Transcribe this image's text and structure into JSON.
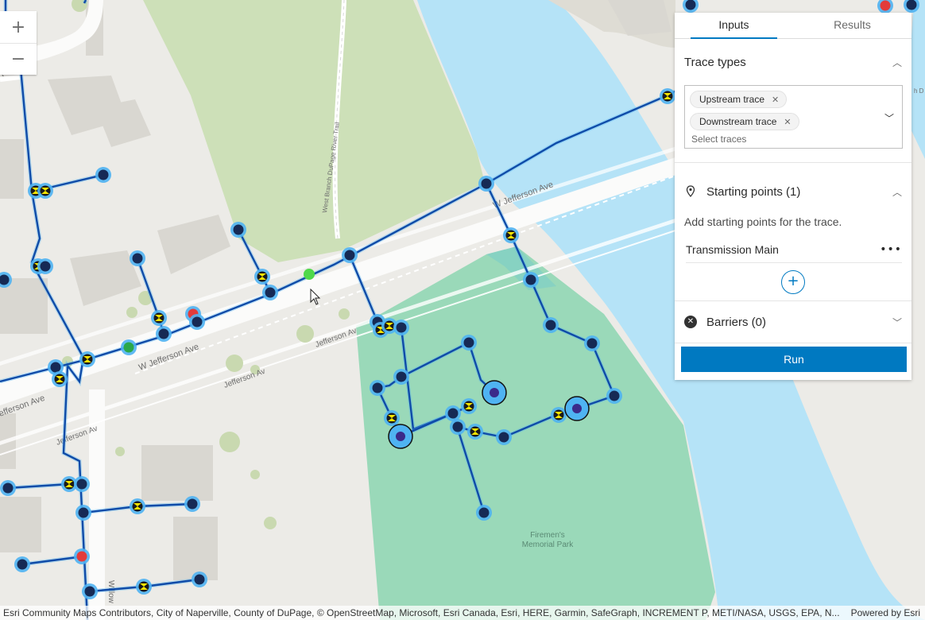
{
  "map": {
    "streets": {
      "w_jefferson_ave_west": "W Jefferson Ave",
      "w_jefferson_ave_east": "W Jefferson Ave",
      "jefferson_ave_1": "Jefferson Av",
      "jefferson_ave_2": "Jefferson Av",
      "jefferson_ave_3": "Jefferson Av",
      "jefferson_ave_edge": "efferson Ave",
      "river_trail": "West Branch DuPage River Trail",
      "willow": "Willow",
      "fragment_ct": "t",
      "fragment_d": "h D"
    },
    "park_name_line1": "Firemen's",
    "park_name_line2": "Memorial Park",
    "colors": {
      "water": "#b5e3f7",
      "park": "#96d8b6",
      "pipe": "#0f4ba8",
      "selection": "#4fb3f2",
      "starting_point": "#4fd84a"
    }
  },
  "zoom": {
    "in_label": "+",
    "out_label": "−"
  },
  "panel": {
    "tabs": [
      {
        "label": "Inputs",
        "active": true
      },
      {
        "label": "Results",
        "active": false
      }
    ],
    "trace_types": {
      "title": "Trace types",
      "chips": [
        {
          "label": "Upstream trace"
        },
        {
          "label": "Downstream trace"
        }
      ],
      "placeholder": "Select traces"
    },
    "starting_points": {
      "title": "Starting points (1)",
      "description": "Add starting points for the trace.",
      "items": [
        {
          "label": "Transmission Main"
        }
      ],
      "add_label": "+"
    },
    "barriers": {
      "title": "Barriers (0)"
    },
    "run_label": "Run"
  },
  "attribution": {
    "text": "Esri Community Maps Contributors, City of Naperville, County of DuPage, © OpenStreetMap, Microsoft, Esri Canada, Esri, HERE, Garmin, SafeGraph, INCREMENT P, METI/NASA, USGS, EPA, N...",
    "powered_by": "Powered by Esri"
  }
}
